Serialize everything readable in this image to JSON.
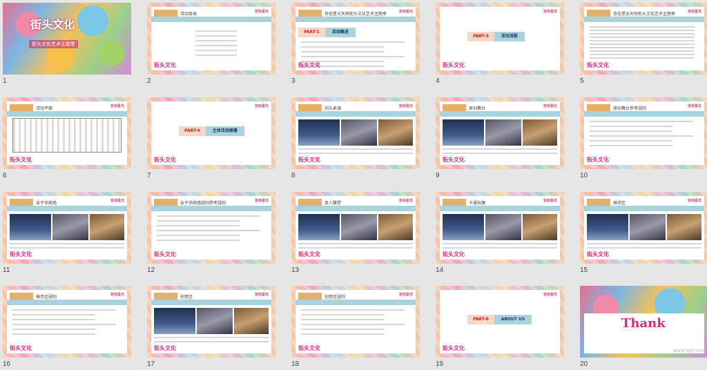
{
  "slides": [
    {
      "number": "1",
      "kind": "cover",
      "title": "街头文化",
      "subtitle": "街头文化艺术主题季"
    },
    {
      "number": "2",
      "kind": "toc",
      "header": "活动目录"
    },
    {
      "number": "3",
      "kind": "text-header",
      "header": "协信星光天地街头文化艺术主题季",
      "part": "PART-1",
      "part_title": "活动概述"
    },
    {
      "number": "4",
      "kind": "part",
      "part": "PART-3",
      "part_title": "活动流程"
    },
    {
      "number": "5",
      "kind": "list",
      "header": "协信星光天地街头文化艺术主题季"
    },
    {
      "number": "6",
      "kind": "diagram",
      "header": "活动平面"
    },
    {
      "number": "7",
      "kind": "part",
      "part": "PART-4",
      "part_title": "主体活动展播"
    },
    {
      "number": "8",
      "kind": "photo",
      "header": "乐队表演"
    },
    {
      "number": "9",
      "kind": "photo",
      "header": "原创舞台"
    },
    {
      "number": "10",
      "kind": "text",
      "header": "原创舞台参考规则"
    },
    {
      "number": "11",
      "kind": "photo",
      "header": "亲子涂鸦墙"
    },
    {
      "number": "12",
      "kind": "text",
      "header": "亲子涂鸦墙规则参考规则"
    },
    {
      "number": "13",
      "kind": "photo",
      "header": "真人雕塑"
    },
    {
      "number": "14",
      "kind": "photo",
      "header": "卡通玩偶"
    },
    {
      "number": "15",
      "kind": "photo",
      "header": "摊手区"
    },
    {
      "number": "16",
      "kind": "text",
      "header": "摊手区规则"
    },
    {
      "number": "17",
      "kind": "photo",
      "header": "创意区"
    },
    {
      "number": "18",
      "kind": "text",
      "header": "创意区规则"
    },
    {
      "number": "19",
      "kind": "part",
      "part": "PART-6",
      "part_title": "ABOUT US"
    },
    {
      "number": "20",
      "kind": "thanks",
      "title": "Thank"
    }
  ],
  "common": {
    "footer_logo": "街头文化",
    "brand": "协信星光"
  },
  "watermark": "www.ppt.com"
}
